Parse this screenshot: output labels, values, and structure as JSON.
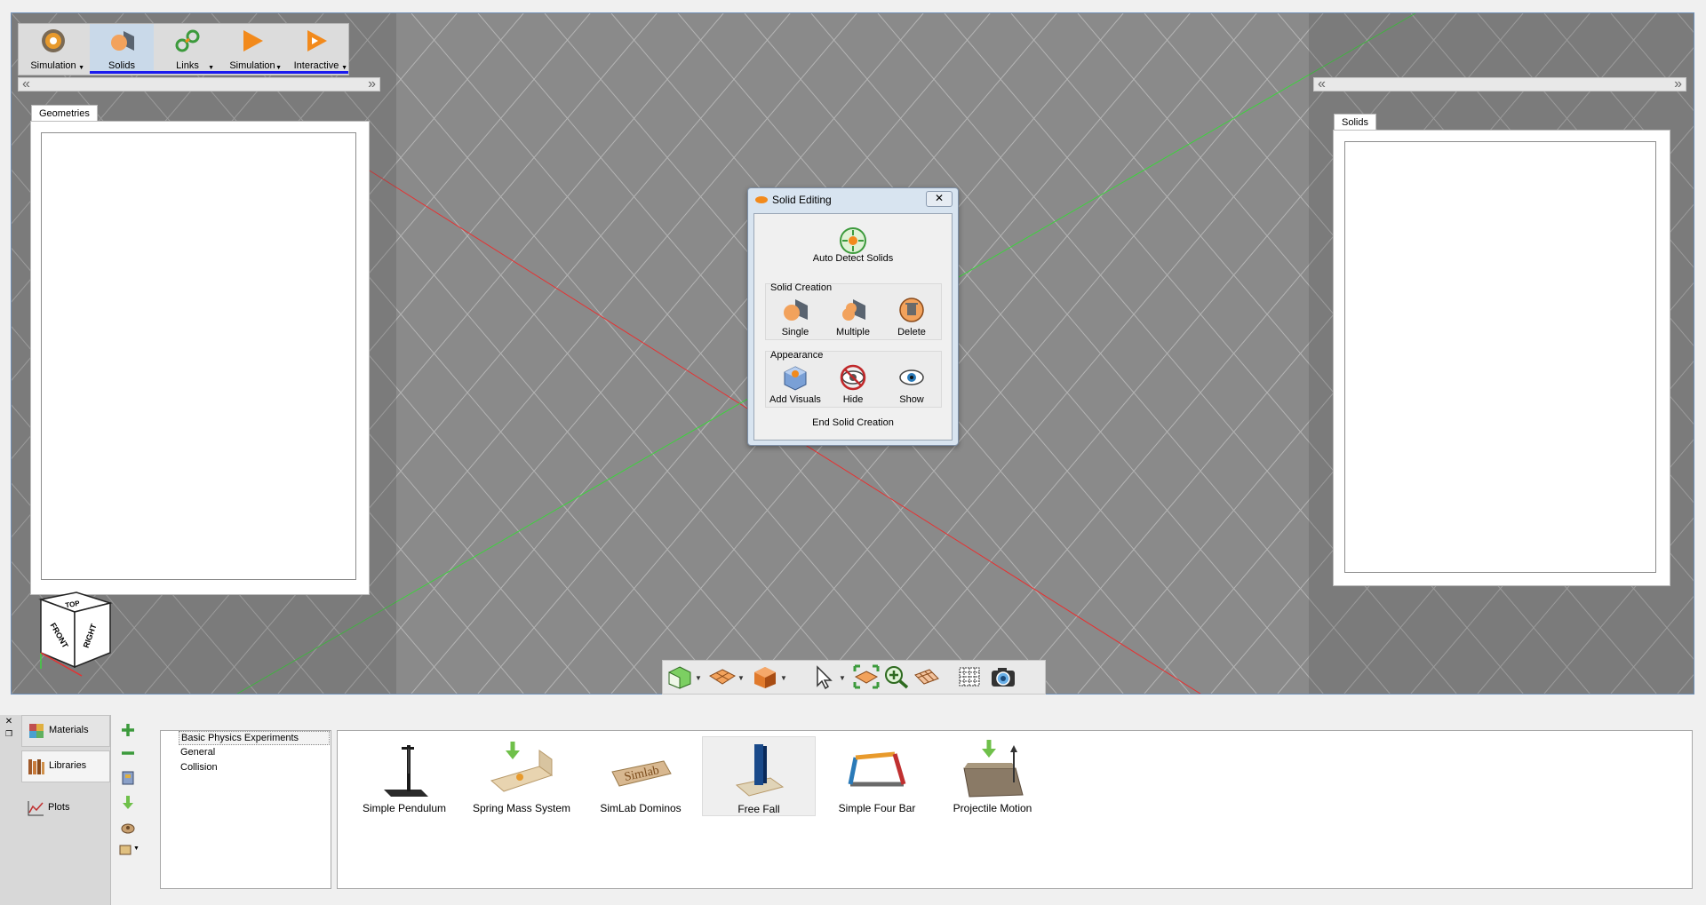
{
  "ribbon": {
    "app_menu_label": "Simulation",
    "tabs": [
      {
        "label": "Solids",
        "icon": "solids-icon"
      },
      {
        "label": "Links",
        "icon": "links-icon"
      },
      {
        "label": "Simulation",
        "icon": "play-icon"
      },
      {
        "label": "Interactive",
        "icon": "interactive-play-icon"
      }
    ]
  },
  "left_panel": {
    "tab_label": "Geometries"
  },
  "right_panel": {
    "tab_label": "Solids"
  },
  "orientation_cube": {
    "top": "TOP",
    "front": "FRONT",
    "right": "RIGHT"
  },
  "dialog": {
    "title": "Solid Editing",
    "close_label": "✕",
    "auto_detect_label": "Auto Detect Solids",
    "solid_creation": {
      "title": "Solid Creation",
      "buttons": [
        "Single",
        "Multiple",
        "Delete"
      ]
    },
    "appearance": {
      "title": "Appearance",
      "buttons": [
        "Add Visuals",
        "Hide",
        "Show"
      ]
    },
    "end_label": "End Solid Creation"
  },
  "bottom_nav": {
    "items": [
      "Materials",
      "Libraries",
      "Plots"
    ],
    "selected": "Libraries"
  },
  "tree": {
    "items": [
      "Basic Physics Experiments",
      "General",
      "Collision"
    ]
  },
  "gallery": {
    "items": [
      "Simple Pendulum",
      "Spring Mass System",
      "SimLab Dominos",
      "Free Fall",
      "Simple Four Bar",
      "Projectile Motion"
    ],
    "selected": "Free Fall"
  },
  "colors": {
    "viewport_bg": "#8a8a8a",
    "x_axis": "#e83030",
    "y_axis": "#3ed23e",
    "accent_orange": "#f28a1c",
    "ribbon_underline": "#1a1aee"
  }
}
